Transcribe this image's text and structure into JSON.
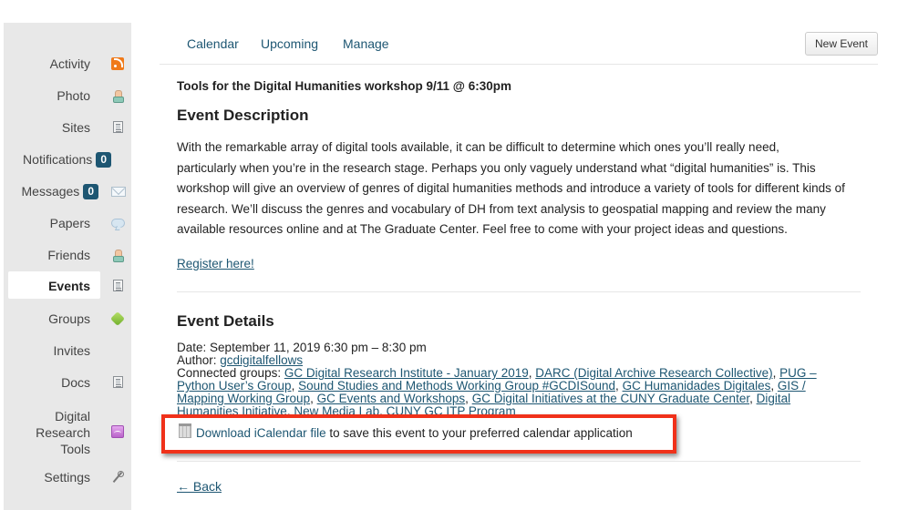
{
  "sidebar": {
    "items": [
      {
        "label": "Activity",
        "icon": "rss-icon"
      },
      {
        "label": "Photo",
        "icon": "person-icon"
      },
      {
        "label": "Sites",
        "icon": "document-icon"
      },
      {
        "label": "Notifications",
        "badge": "0"
      },
      {
        "label": "Messages",
        "badge": "0",
        "icon": "mail-icon"
      },
      {
        "label": "Papers",
        "icon": "speech-bubble-icon"
      },
      {
        "label": "Friends",
        "icon": "person-icon"
      },
      {
        "label": "Events",
        "icon": "document-icon",
        "active": true
      },
      {
        "label": "Groups",
        "icon": "cube-icon"
      },
      {
        "label": "Invites"
      },
      {
        "label": "Docs",
        "icon": "document-icon"
      },
      {
        "label_lines": [
          "Digital",
          "Research",
          "Tools"
        ],
        "icon": "research-tools-icon"
      },
      {
        "label": "Settings",
        "icon": "wrench-icon"
      }
    ]
  },
  "tabs": [
    {
      "label": "Calendar"
    },
    {
      "label": "Upcoming"
    },
    {
      "label": "Manage"
    }
  ],
  "new_event_button": "New Event",
  "event": {
    "title": "Tools for the Digital Humanities workshop 9/11 @ 6:30pm",
    "description_heading": "Event Description",
    "description_lines": [
      "With the remarkable array of digital tools available, it can be difficult to determine which ones you’ll really need,",
      "particularly when you’re in the research stage. Perhaps you only vaguely understand what “digital humanities” is. This",
      "workshop will give an overview of genres of digital humanities methods and introduce a variety of tools for different kinds of",
      "research. We’ll discuss the genres and vocabulary of DH from text analysis to geospatial mapping and review the many",
      "available resources online and at The Graduate Center. Feel free to come with your project ideas and questions."
    ],
    "register_link": "Register here!",
    "details_heading": "Event Details",
    "date_label": "Date:",
    "date_value": "September 11, 2019 6:30 pm – 8:30 pm",
    "author_label": "Author:",
    "author_value": "gcdigitalfellows",
    "groups_label": "Connected groups:",
    "groups": [
      "GC Digital Research Institute - January 2019",
      "DARC (Digital Archive Research Collective)",
      "PUG – Python User’s Group",
      "Sound Studies and Methods Working Group #GCDISound",
      "GC Humanidades Digitales",
      "GIS / Mapping Working Group",
      "GC Events and Workshops",
      "GC Digital Initiatives at the CUNY Graduate Center",
      "Digital Humanities Initiative",
      "New Media Lab",
      "CUNY GC ITP Program"
    ],
    "ical_link": "Download iCalendar file",
    "ical_text": " to save this event to your preferred calendar application",
    "back_link": "← Back"
  },
  "colors": {
    "link": "#1d5672",
    "badge": "#1d5672",
    "highlight_border": "#f0311a",
    "sidebar_bg": "#e8e8e8"
  }
}
